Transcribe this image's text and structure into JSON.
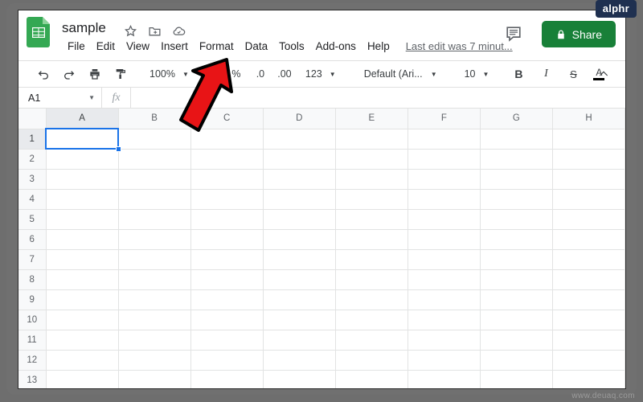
{
  "branding": {
    "logo_text": "alphr",
    "watermark": "www.deuaq.com",
    "logo_bg": "#1f3050"
  },
  "header": {
    "app_icon": "sheets-icon",
    "doc_title": "sample",
    "title_icons": [
      "star-icon",
      "move-to-folder-icon",
      "cloud-saved-icon"
    ],
    "menus": [
      "File",
      "Edit",
      "View",
      "Insert",
      "Format",
      "Data",
      "Tools",
      "Add-ons",
      "Help"
    ],
    "last_edit": "Last edit was 7 minut...",
    "comment_icon": "comment-icon",
    "share_label": "Share",
    "share_icon": "lock-icon",
    "share_color": "#188038"
  },
  "toolbar": {
    "undo_icon": "undo-icon",
    "redo_icon": "redo-icon",
    "print_icon": "print-icon",
    "paint_format_icon": "paint-format-icon",
    "zoom_value": "100%",
    "percent_label": "%",
    "decrease_decimal_label": ".0",
    "increase_decimal_label": ".00",
    "number_format_label": "123",
    "font_name": "Default (Ari...",
    "font_size": "10",
    "bold_label": "B",
    "italic_label": "I",
    "strikethrough_label": "S",
    "text_color_label": "A",
    "text_color_value": "#000000",
    "more_label": "⋯",
    "collapse_icon": "chevron-up-icon"
  },
  "formula_bar": {
    "name_box_value": "A1",
    "fx_label": "fx",
    "formula_value": ""
  },
  "grid": {
    "columns": [
      "A",
      "B",
      "C",
      "D",
      "E",
      "F",
      "G",
      "H"
    ],
    "rows": [
      "1",
      "2",
      "3",
      "4",
      "5",
      "6",
      "7",
      "8",
      "9",
      "10",
      "11",
      "12",
      "13"
    ],
    "active_column": "A",
    "active_row": "1",
    "selected_cell": "A1",
    "selection_color": "#1a73e8",
    "cells": []
  },
  "annotation": {
    "type": "arrow",
    "points_to": "Format",
    "fill": "#e81416",
    "stroke": "#000000"
  }
}
